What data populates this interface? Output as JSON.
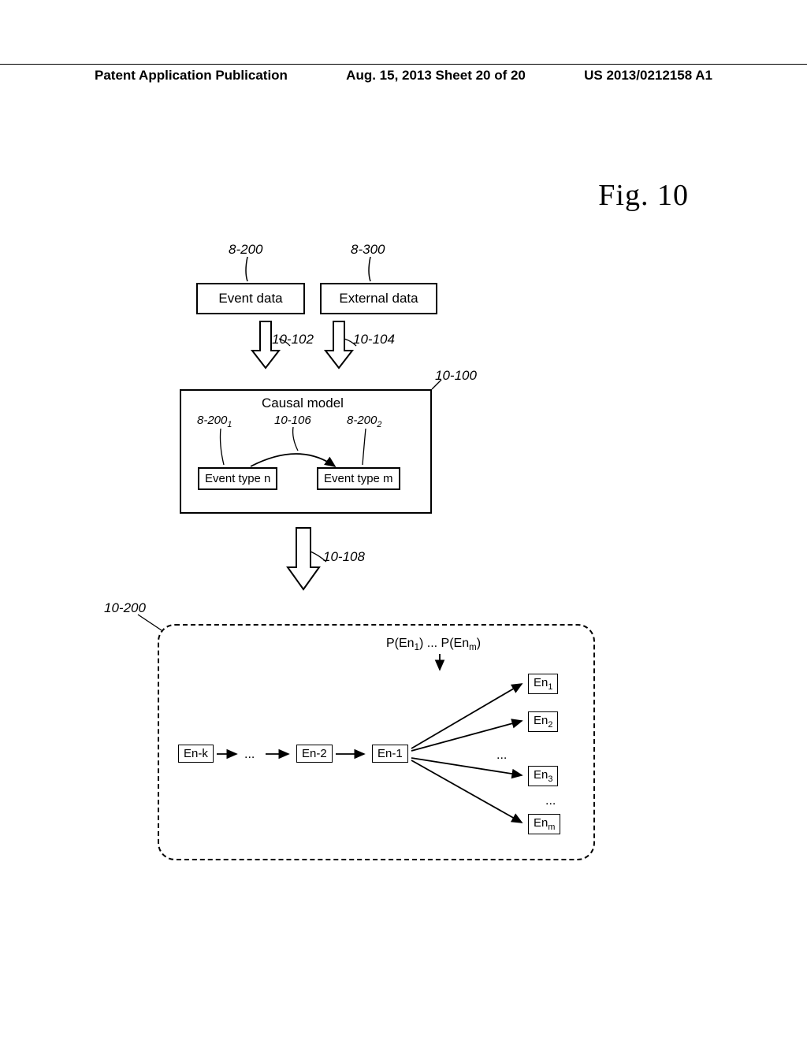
{
  "header": {
    "left": "Patent Application Publication",
    "center": "Aug. 15, 2013  Sheet 20 of 20",
    "right": "US 2013/0212158 A1"
  },
  "figure_title": "Fig. 10",
  "labels": {
    "l_8_200": "8-200",
    "l_8_300": "8-300",
    "l_10_102": "10-102",
    "l_10_104": "10-104",
    "l_10_100": "10-100",
    "l_8_200_1": "8-200",
    "l_8_200_1_sub": "1",
    "l_10_106": "10-106",
    "l_8_200_2": "8-200",
    "l_8_200_2_sub": "2",
    "l_10_108": "10-108",
    "l_10_200": "10-200"
  },
  "boxes": {
    "event_data": "Event data",
    "external_data": "External data",
    "causal_model": "Causal model",
    "event_type_n": "Event type n",
    "event_type_m": "Event type m",
    "en_k": "En-k",
    "en_2": "En-2",
    "en_1": "En-1",
    "en1": "En",
    "en1_sub": "1",
    "en2": "En",
    "en2_sub": "2",
    "en3": "En",
    "en3_sub": "3",
    "enm": "En",
    "enm_sub": "m"
  },
  "prob": {
    "p_left": "P(En",
    "p_left_sub": "1",
    "p_dots": ") ... P(En",
    "p_right_sub": "m",
    "p_right": ")"
  },
  "misc": {
    "ellipsis": "...",
    "arrow_dots": "...",
    "more_dots": "..."
  }
}
